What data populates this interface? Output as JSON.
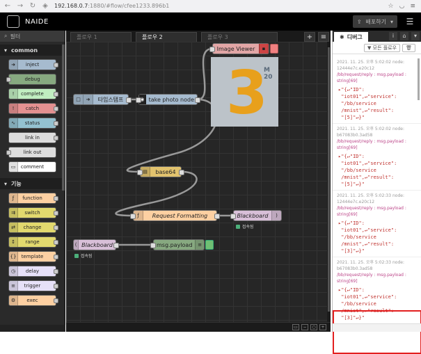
{
  "browser": {
    "url_main": "192.168.0.7",
    "url_rest": ":1880/#flow/cfee1233.896b1"
  },
  "header": {
    "title": "NAIDE",
    "deploy_label": "배포하기"
  },
  "palette": {
    "filter_placeholder": "필터",
    "categories": [
      {
        "label": "common",
        "nodes": [
          "inject",
          "debug",
          "complete",
          "catch",
          "status",
          "link in",
          "link out",
          "comment"
        ]
      },
      {
        "label": "기능",
        "nodes": [
          "function",
          "switch",
          "change",
          "range",
          "template",
          "delay",
          "trigger",
          "exec"
        ]
      }
    ],
    "colors": {
      "inject": "#a6bbcf",
      "debug": "#87a980",
      "complete": "#c0edc0",
      "catch": "#e49191",
      "status": "#94c1d0",
      "link": "#dddddd",
      "comment": "#ffffff",
      "function": "#fdd0a2",
      "switch": "#e2d96e",
      "change": "#e2d96e",
      "range": "#e2d96e",
      "template": "#fdd0a2",
      "delay": "#e6e0f8",
      "trigger": "#e6e0f8",
      "exec": "#fdd0a2"
    }
  },
  "tabs": {
    "items": [
      "플로우 1",
      "플로우 2",
      "플로우 3"
    ],
    "active": "플로우 2"
  },
  "canvas": {
    "nodes": {
      "timestamp": "타임스탬프",
      "take_photo": "take photo node",
      "image_viewer": "Image Viewer",
      "base64": "base64",
      "request_formatting": "Request Formatting",
      "blackboard_out": "Blackboard",
      "blackboard_in": "Blackboard",
      "msg_payload": "msg.payload"
    },
    "status_connected": "접속됨",
    "image_digit": "3",
    "image_text": "M\n20"
  },
  "sidebar": {
    "tab_label": "디버그",
    "filter_button": "모든 플로우",
    "messages": [
      {
        "time": "2021. 11. 25. 오후 5:02:02",
        "node": "node:",
        "node_id": "12444e7c.e20c12",
        "topic": "/bb/request/reply : msg.payload :",
        "type": "string[69]",
        "payload": "▸\"{↵\"ID\":\n \"iot01\",↵\"service\":\n \"/bb/service\n /mnist\",↵\"result\":\n \"[5]\"↵}\""
      },
      {
        "time": "2021. 11. 25. 오후 5:02:02",
        "node": "node:",
        "node_id": "b67083b0.3ad58",
        "topic": "/bb/request/reply : msg.payload :",
        "type": "string[69]",
        "payload": "▸\"{↵\"ID\":\n \"iot01\",↵\"service\":\n \"/bb/service\n /mnist\",↵\"result\":\n \"[5]\"↵}\""
      },
      {
        "time": "2021. 11. 25. 오후 5:02:33",
        "node": "node:",
        "node_id": "12444e7c.e20c12",
        "topic": "/bb/request/reply : msg.payload :",
        "type": "string[69]",
        "payload": "▸\"{↵\"ID\":\n \"iot01\",↵\"service\":\n \"/bb/service\n /mnist\",↵\"result\":\n \"[3]\"↵}\""
      },
      {
        "time": "2021. 11. 25. 오후 5:02:33",
        "node": "node:",
        "node_id": "b67083b0.3ad58",
        "topic": "/bb/request/reply : msg.payload :",
        "type": "string[69]",
        "payload": "▸\"{↵\"ID\":\n \"iot01\",↵\"service\":\n \"/bb/service\n /mnist\",↵\"result\":\n \"[3]\"↵}\""
      }
    ]
  }
}
